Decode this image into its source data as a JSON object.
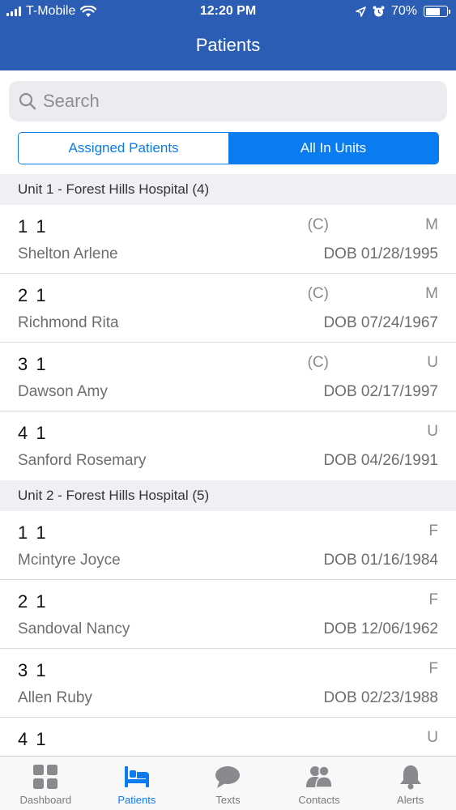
{
  "status_bar": {
    "carrier": "T-Mobile",
    "time": "12:20 PM",
    "battery": "70%",
    "battery_level": 0.7
  },
  "header": {
    "title": "Patients"
  },
  "search": {
    "placeholder": "Search",
    "icon": "search-icon"
  },
  "segments": [
    {
      "label": "Assigned Patients",
      "selected": false
    },
    {
      "label": "All In Units",
      "selected": true
    }
  ],
  "sections": [
    {
      "title": "Unit 1 - Forest Hills Hospital (4)",
      "patients": [
        {
          "room": "1 1",
          "flag": "(C)",
          "gender": "M",
          "name": "Shelton Arlene",
          "dob": "DOB 01/28/1995"
        },
        {
          "room": "2 1",
          "flag": "(C)",
          "gender": "M",
          "name": "Richmond Rita",
          "dob": "DOB 07/24/1967"
        },
        {
          "room": "3 1",
          "flag": "(C)",
          "gender": "U",
          "name": "Dawson Amy",
          "dob": "DOB 02/17/1997"
        },
        {
          "room": "4 1",
          "flag": "",
          "gender": "U",
          "name": "Sanford Rosemary",
          "dob": "DOB 04/26/1991"
        }
      ]
    },
    {
      "title": "Unit 2 - Forest Hills Hospital (5)",
      "patients": [
        {
          "room": "1 1",
          "flag": "",
          "gender": "F",
          "name": "Mcintyre Joyce",
          "dob": "DOB 01/16/1984"
        },
        {
          "room": "2 1",
          "flag": "",
          "gender": "F",
          "name": "Sandoval Nancy",
          "dob": "DOB 12/06/1962"
        },
        {
          "room": "3 1",
          "flag": "",
          "gender": "F",
          "name": "Allen Ruby",
          "dob": "DOB 02/23/1988"
        },
        {
          "room": "4 1",
          "flag": "",
          "gender": "U",
          "name": "",
          "dob": ""
        }
      ]
    }
  ],
  "tabs": [
    {
      "label": "Dashboard",
      "icon": "dashboard-icon",
      "active": false
    },
    {
      "label": "Patients",
      "icon": "bed-icon",
      "active": true
    },
    {
      "label": "Texts",
      "icon": "chat-bubble-icon",
      "active": false
    },
    {
      "label": "Contacts",
      "icon": "contacts-icon",
      "active": false
    },
    {
      "label": "Alerts",
      "icon": "bell-icon",
      "active": false
    }
  ],
  "colors": {
    "header_bg": "#2b5db4",
    "accent": "#0a7cf0",
    "section_bg": "#efeff4"
  }
}
